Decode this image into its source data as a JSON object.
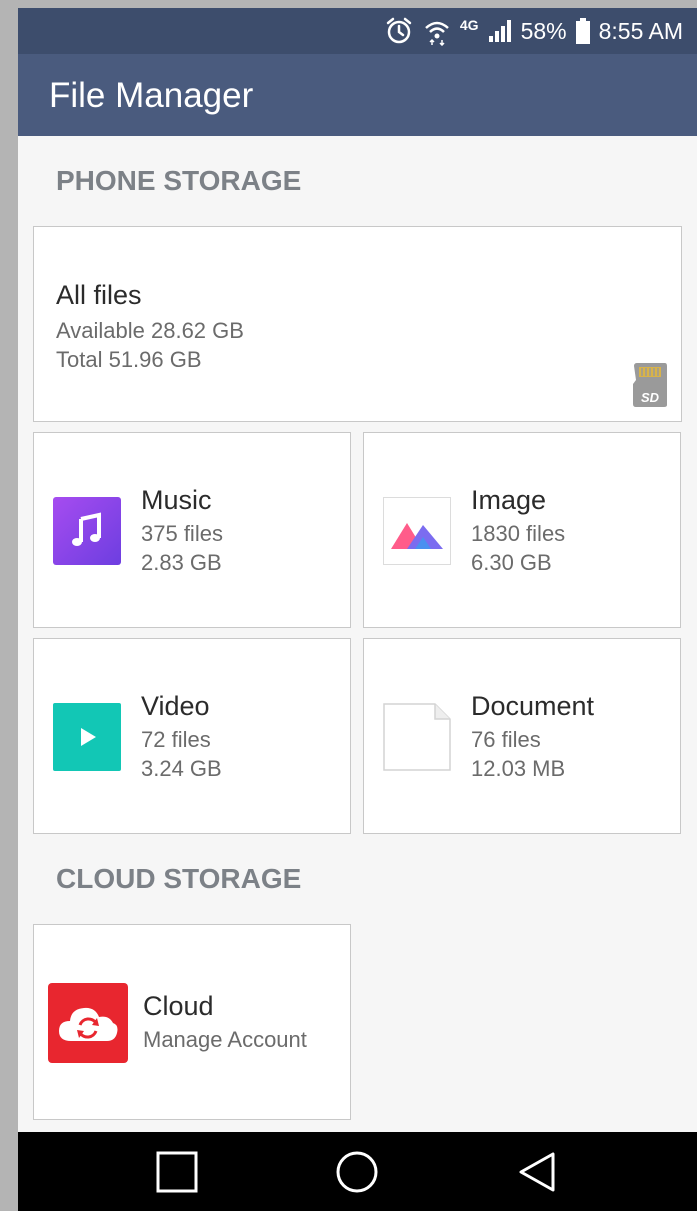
{
  "status_bar": {
    "network": "4G",
    "battery": "58%",
    "time": "8:55 AM"
  },
  "app_bar": {
    "title": "File Manager"
  },
  "phone_storage": {
    "section_title": "PHONE STORAGE",
    "all_files": {
      "title": "All files",
      "available": "Available 28.62 GB",
      "total": "Total 51.96 GB",
      "badge": "SD"
    },
    "categories": [
      {
        "name": "Music",
        "files": "375 files",
        "size": "2.83 GB",
        "icon": "music-note-icon",
        "color": "#8a44e6"
      },
      {
        "name": "Image",
        "files": "1830 files",
        "size": "6.30 GB",
        "icon": "image-mountains-icon",
        "color": "#ff5c8a"
      },
      {
        "name": "Video",
        "files": "72 files",
        "size": "3.24 GB",
        "icon": "play-icon",
        "color": "#10c4b3"
      },
      {
        "name": "Document",
        "files": "76 files",
        "size": "12.03 MB",
        "icon": "document-icon",
        "color": "#ffffff"
      }
    ]
  },
  "cloud_storage": {
    "section_title": "CLOUD STORAGE",
    "cloud": {
      "name": "Cloud",
      "subtitle": "Manage Account",
      "icon": "cloud-sync-icon",
      "color": "#e8262f"
    }
  },
  "nav_bar": {
    "buttons": [
      "recent-apps-icon",
      "home-icon",
      "back-icon"
    ]
  }
}
